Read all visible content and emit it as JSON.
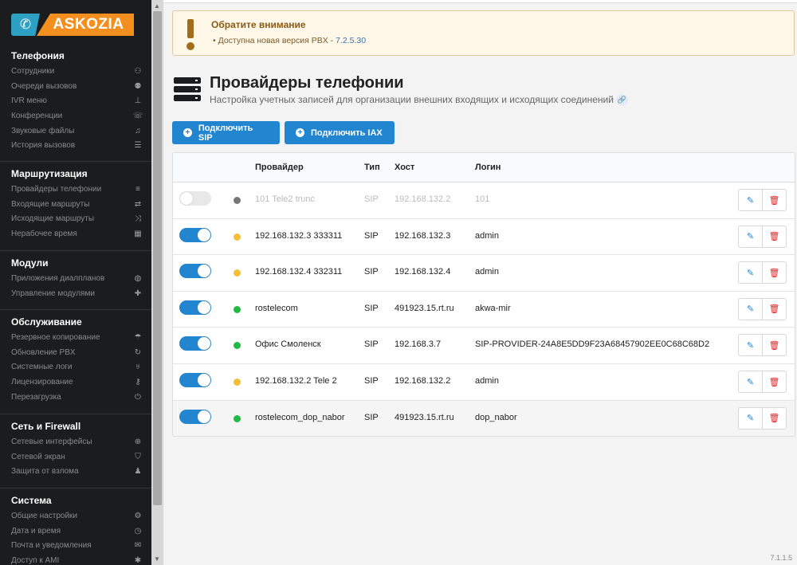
{
  "brand": {
    "logo_text": "ASKOZIA",
    "phone_icon": "phone-icon"
  },
  "sidebar": {
    "sections": [
      {
        "title": "Телефония",
        "items": [
          {
            "label": "Сотрудники",
            "icon": "user-icon",
            "glyph": "⚇"
          },
          {
            "label": "Очереди вызовов",
            "icon": "users-icon",
            "glyph": "⚉"
          },
          {
            "label": "IVR меню",
            "icon": "sitemap-icon",
            "glyph": "⊥"
          },
          {
            "label": "Конференции",
            "icon": "phone-volume-icon",
            "glyph": "☏"
          },
          {
            "label": "Звуковые файлы",
            "icon": "headphones-icon",
            "glyph": "♫"
          },
          {
            "label": "История вызовов",
            "icon": "list-icon",
            "glyph": "☰"
          }
        ]
      },
      {
        "title": "Маршрутизация",
        "items": [
          {
            "label": "Провайдеры телефонии",
            "icon": "server-icon",
            "glyph": "≡"
          },
          {
            "label": "Входящие маршруты",
            "icon": "signpost-icon",
            "glyph": "⇄"
          },
          {
            "label": "Исходящие маршруты",
            "icon": "random-icon",
            "glyph": "⤨"
          },
          {
            "label": "Нерабочее время",
            "icon": "calendar-icon",
            "glyph": "▦"
          }
        ]
      },
      {
        "title": "Модули",
        "items": [
          {
            "label": "Приложения диалпланов",
            "icon": "php-icon",
            "glyph": "◍"
          },
          {
            "label": "Управление модулями",
            "icon": "puzzle-icon",
            "glyph": "✚"
          }
        ]
      },
      {
        "title": "Обслуживание",
        "items": [
          {
            "label": "Резервное копирование",
            "icon": "umbrella-icon",
            "glyph": "☂"
          },
          {
            "label": "Обновление PBX",
            "icon": "sync-icon",
            "glyph": "↻"
          },
          {
            "label": "Системные логи",
            "icon": "stethoscope-icon",
            "glyph": "♅"
          },
          {
            "label": "Лицензирование",
            "icon": "key-icon",
            "glyph": "⚷"
          },
          {
            "label": "Перезагрузка",
            "icon": "power-icon",
            "glyph": "⏻"
          }
        ]
      },
      {
        "title": "Сеть и Firewall",
        "items": [
          {
            "label": "Сетевые интерфейсы",
            "icon": "network-icon",
            "glyph": "⊕"
          },
          {
            "label": "Сетевой экран",
            "icon": "shield-icon",
            "glyph": "⛉"
          },
          {
            "label": "Защита от взлома",
            "icon": "user-secret-icon",
            "glyph": "♟"
          }
        ]
      },
      {
        "title": "Система",
        "items": [
          {
            "label": "Общие настройки",
            "icon": "cogs-icon",
            "glyph": "⚙"
          },
          {
            "label": "Дата и время",
            "icon": "clock-icon",
            "glyph": "◷"
          },
          {
            "label": "Почта и уведомления",
            "icon": "envelope-icon",
            "glyph": "✉"
          },
          {
            "label": "Доступ к AMI",
            "icon": "asterisk-icon",
            "glyph": "✱"
          }
        ]
      }
    ]
  },
  "alert": {
    "title": "Обратите внимание",
    "message_prefix": "• Доступна новая версия PBX - ",
    "version_link": "7.2.5.30"
  },
  "page": {
    "title": "Провайдеры телефонии",
    "subtitle": "Настройка учетных записей для организации внешних входящих и исходящих соединений"
  },
  "buttons": {
    "add_sip": "Подключить SIP",
    "add_iax": "Подключить IAX"
  },
  "table": {
    "headers": {
      "provider": "Провайдер",
      "type": "Тип",
      "host": "Хост",
      "login": "Логин"
    },
    "rows": [
      {
        "enabled": false,
        "status": "#777777",
        "provider": "101 Tele2 trunc",
        "type": "SIP",
        "host": "192.168.132.2",
        "login": "101"
      },
      {
        "enabled": true,
        "status": "#f2c037",
        "provider": "192.168.132.3 333311",
        "type": "SIP",
        "host": "192.168.132.3",
        "login": "admin"
      },
      {
        "enabled": true,
        "status": "#f2c037",
        "provider": "192.168.132.4 332311",
        "type": "SIP",
        "host": "192.168.132.4",
        "login": "admin"
      },
      {
        "enabled": true,
        "status": "#21ba45",
        "provider": "rostelecom",
        "type": "SIP",
        "host": "491923.15.rt.ru",
        "login": "akwa-mir"
      },
      {
        "enabled": true,
        "status": "#21ba45",
        "provider": "Офис Смоленск",
        "type": "SIP",
        "host": "192.168.3.7",
        "login": "SIP-PROVIDER-24A8E5DD9F23A68457902EE0C68C68D2"
      },
      {
        "enabled": true,
        "status": "#f2c037",
        "provider": "192.168.132.2 Tele 2",
        "type": "SIP",
        "host": "192.168.132.2",
        "login": "admin"
      },
      {
        "enabled": true,
        "status": "#21ba45",
        "provider": "rostelecom_dop_nabor",
        "type": "SIP",
        "host": "491923.15.rt.ru",
        "login": "dop_nabor"
      }
    ]
  },
  "version": "7.1.1.5"
}
